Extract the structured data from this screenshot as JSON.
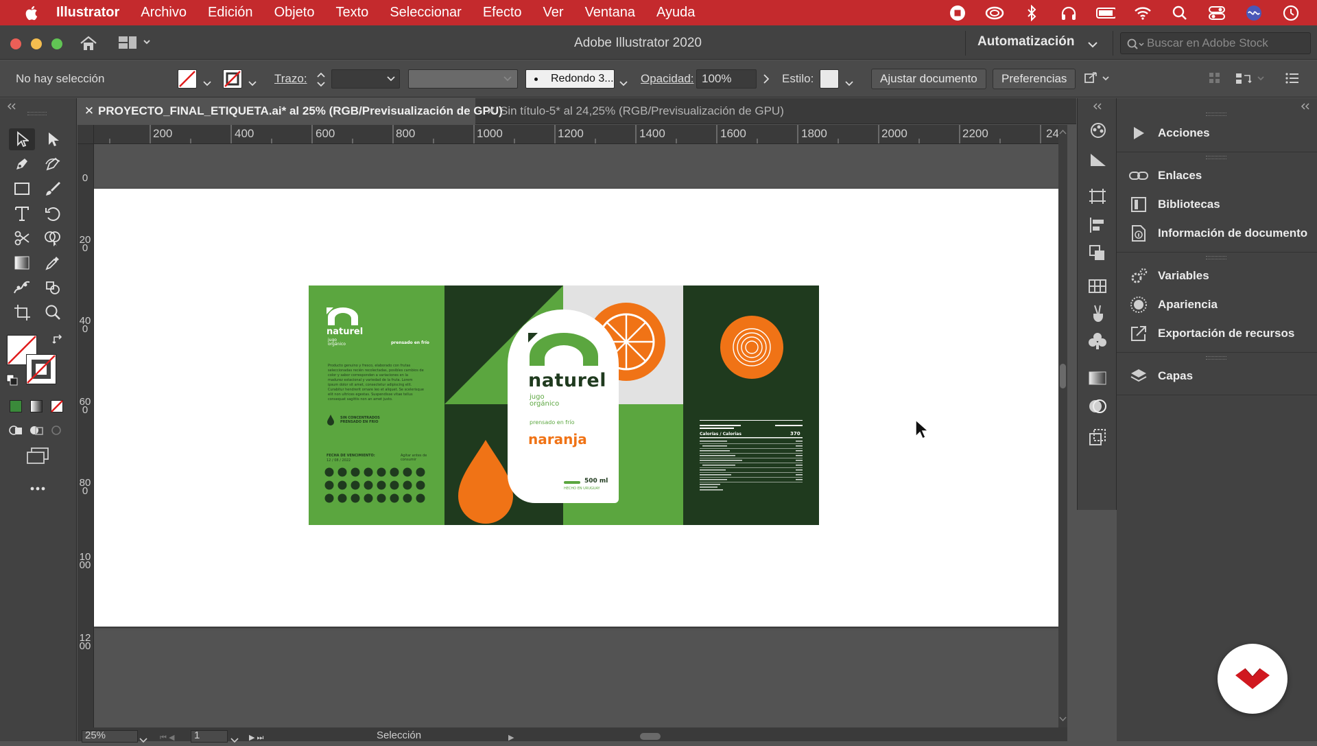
{
  "menubar": {
    "app_name": "Illustrator",
    "items": [
      "Archivo",
      "Edición",
      "Objeto",
      "Texto",
      "Seleccionar",
      "Efecto",
      "Ver",
      "Ventana",
      "Ayuda"
    ]
  },
  "titlebar": {
    "window_title": "Adobe Illustrator 2020",
    "workspace": "Automatización",
    "search_placeholder": "Buscar en Adobe Stock"
  },
  "controlbar": {
    "selection_status": "No hay selección",
    "stroke_label": "Trazo:",
    "brush_label": "Redondo 3...",
    "opacity_label": "Opacidad:",
    "opacity_value": "100%",
    "style_label": "Estilo:",
    "fit_document_button": "Ajustar documento",
    "preferences_button": "Preferencias"
  },
  "tabs": [
    {
      "label": "PROYECTO_FINAL_ETIQUETA.ai* al 25% (RGB/Previsualización de GPU)",
      "active": true
    },
    {
      "label": "Sin título-5* al 24,25% (RGB/Previsualización de GPU)",
      "active": false
    }
  ],
  "rulers": {
    "horizontal": [
      "200",
      "400",
      "600",
      "800",
      "1000",
      "1200",
      "1400",
      "1600",
      "1800",
      "2000",
      "2200",
      "24"
    ],
    "vertical": [
      "0",
      "200",
      "400",
      "600",
      "800",
      "1000",
      "1200"
    ]
  },
  "statusbar": {
    "zoom": "25%",
    "artboard_number": "1",
    "tool_name": "Selección"
  },
  "panels": {
    "items": [
      {
        "label": "Acciones",
        "icon": "play-icon"
      },
      {
        "label": "Enlaces",
        "icon": "link-icon"
      },
      {
        "label": "Bibliotecas",
        "icon": "library-icon"
      },
      {
        "label": "Información de documento",
        "icon": "info-icon"
      },
      {
        "label": "Variables",
        "icon": "variables-icon"
      },
      {
        "label": "Apariencia",
        "icon": "appearance-icon"
      },
      {
        "label": "Exportación de recursos",
        "icon": "export-icon"
      },
      {
        "label": "Capas",
        "icon": "layers-icon"
      }
    ]
  },
  "label_design": {
    "brand": "naturel",
    "brand_small": "naturel",
    "tagline_small": "jugo orgánico",
    "tagline": "jugo orgánico",
    "pressed_small": "prensado en frío",
    "pressed": "prensado en frío",
    "flavor": "naranja",
    "volume": "500 ml",
    "origin": "HECHO EN URUGUAY",
    "body_text": "Producto genuino y fresco, elaborado con frutas seleccionadas recién recolectadas, posibles cambios de color y sabor corresponden a variaciones en la madurez estacional y variedad de la fruta. Lorem ipsum dolor sit amet, consectetur adipiscing elit. Curabitur hendrerit ornare leo et aliquet. Se scelerisque elit non ultrices egestas. Suspendisse vitae tellus consequat sagittis non an amet justo.",
    "no_concentrates": "SIN CONCENTRADOS PRENSADO EN FRIO",
    "expiry_label": "FECHA DE VENCIMIENTO:",
    "expiry_date": "12 / 08 / 2022",
    "shake_note": "Agitar antes de consumir",
    "nutrition_title": "Calorías / Calorias",
    "nutrition_value": "370",
    "colors": {
      "green": "#5ba63f",
      "dark_green": "#1f3a1e",
      "orange": "#f07316",
      "grey": "#e2e2e2"
    }
  }
}
